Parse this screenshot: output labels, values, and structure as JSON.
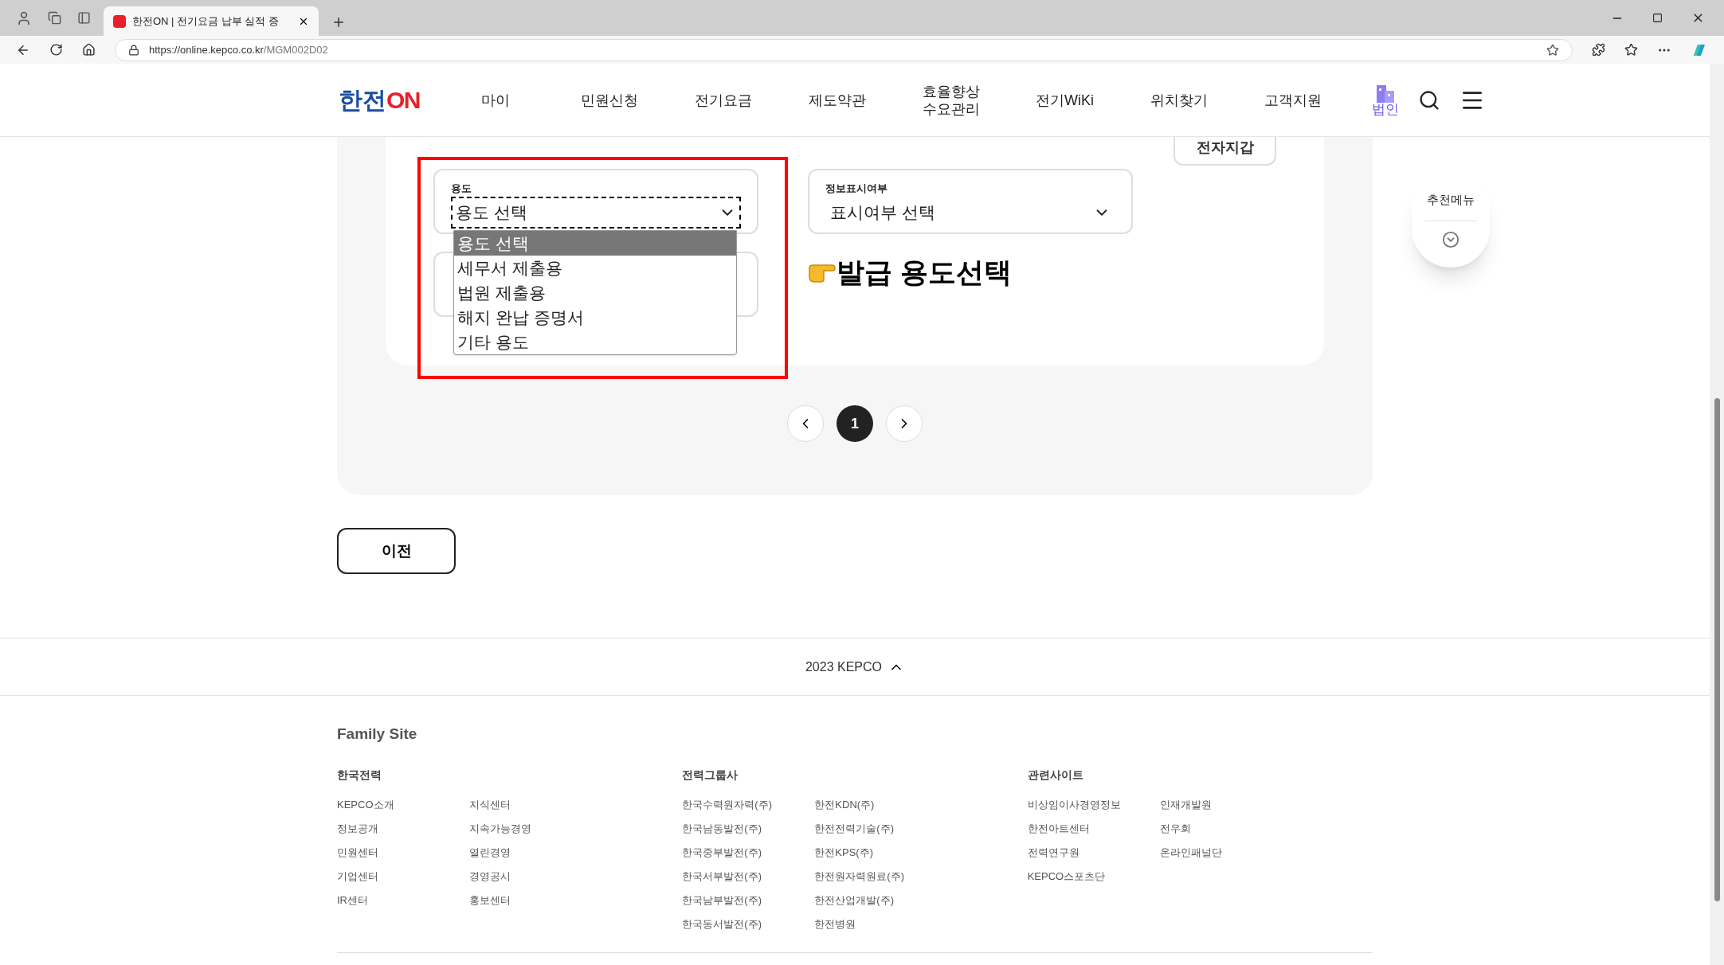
{
  "browser": {
    "tab_title": "한전ON | 전기요금 납부 실적 증",
    "url_host": "https://online.kepco.co.kr",
    "url_path": "/MGM002D02"
  },
  "header": {
    "logo": {
      "brand": "한전",
      "suffix": "ON"
    },
    "nav": [
      {
        "label": "마이"
      },
      {
        "label": "민원신청"
      },
      {
        "label": "전기요금"
      },
      {
        "label": "제도약관"
      },
      {
        "label": "효율향상\n수요관리"
      },
      {
        "label": "전기WiKi"
      },
      {
        "label": "위치찾기"
      },
      {
        "label": "고객지원"
      }
    ],
    "corporate_label": "법인"
  },
  "content": {
    "wallet_button": "전자지갑",
    "selects": [
      {
        "label": "용도",
        "value": "용도 선택",
        "focused": true,
        "options": [
          {
            "label": "용도 선택",
            "selected": true
          },
          {
            "label": "세무서 제출용",
            "selected": false
          },
          {
            "label": "법원 제출용",
            "selected": false
          },
          {
            "label": "해지 완납 증명서",
            "selected": false
          },
          {
            "label": "기타 용도",
            "selected": false
          }
        ]
      },
      {
        "label": "정보표시여부",
        "value": "표시여부 선택",
        "focused": false
      }
    ],
    "annotation": "발급 용도선택",
    "pagination": [
      {
        "label": "1",
        "selected": true
      }
    ],
    "back_button": "이전"
  },
  "recommend": {
    "label": "추천메뉴"
  },
  "footer": {
    "copyright": "2023 KEPCO",
    "family_title": "Family Site",
    "groups": [
      {
        "title": "한국전력",
        "columns": [
          [
            "KEPCO소개",
            "정보공개",
            "민원센터",
            "기업센터",
            "IR센터"
          ],
          [
            "지식센터",
            "지속가능경영",
            "열린경영",
            "경영공시",
            "홍보센터"
          ]
        ]
      },
      {
        "title": "전력그룹사",
        "columns": [
          [
            "한국수력원자력(주)",
            "한국남동발전(주)",
            "한국중부발전(주)",
            "한국서부발전(주)",
            "한국남부발전(주)",
            "한국동서발전(주)"
          ],
          [
            "한전KDN(주)",
            "한전전력기술(주)",
            "한전KPS(주)",
            "한전원자력원료(주)",
            "한전산업개발(주)",
            "한전병원"
          ]
        ]
      },
      {
        "title": "관련사이트",
        "columns": [
          [
            "비상임이사경영정보",
            "한전아트센터",
            "전력연구원",
            "KEPCO스포츠단"
          ],
          [
            "인재개발원",
            "전우회",
            "온라인패널단"
          ]
        ]
      }
    ]
  }
}
